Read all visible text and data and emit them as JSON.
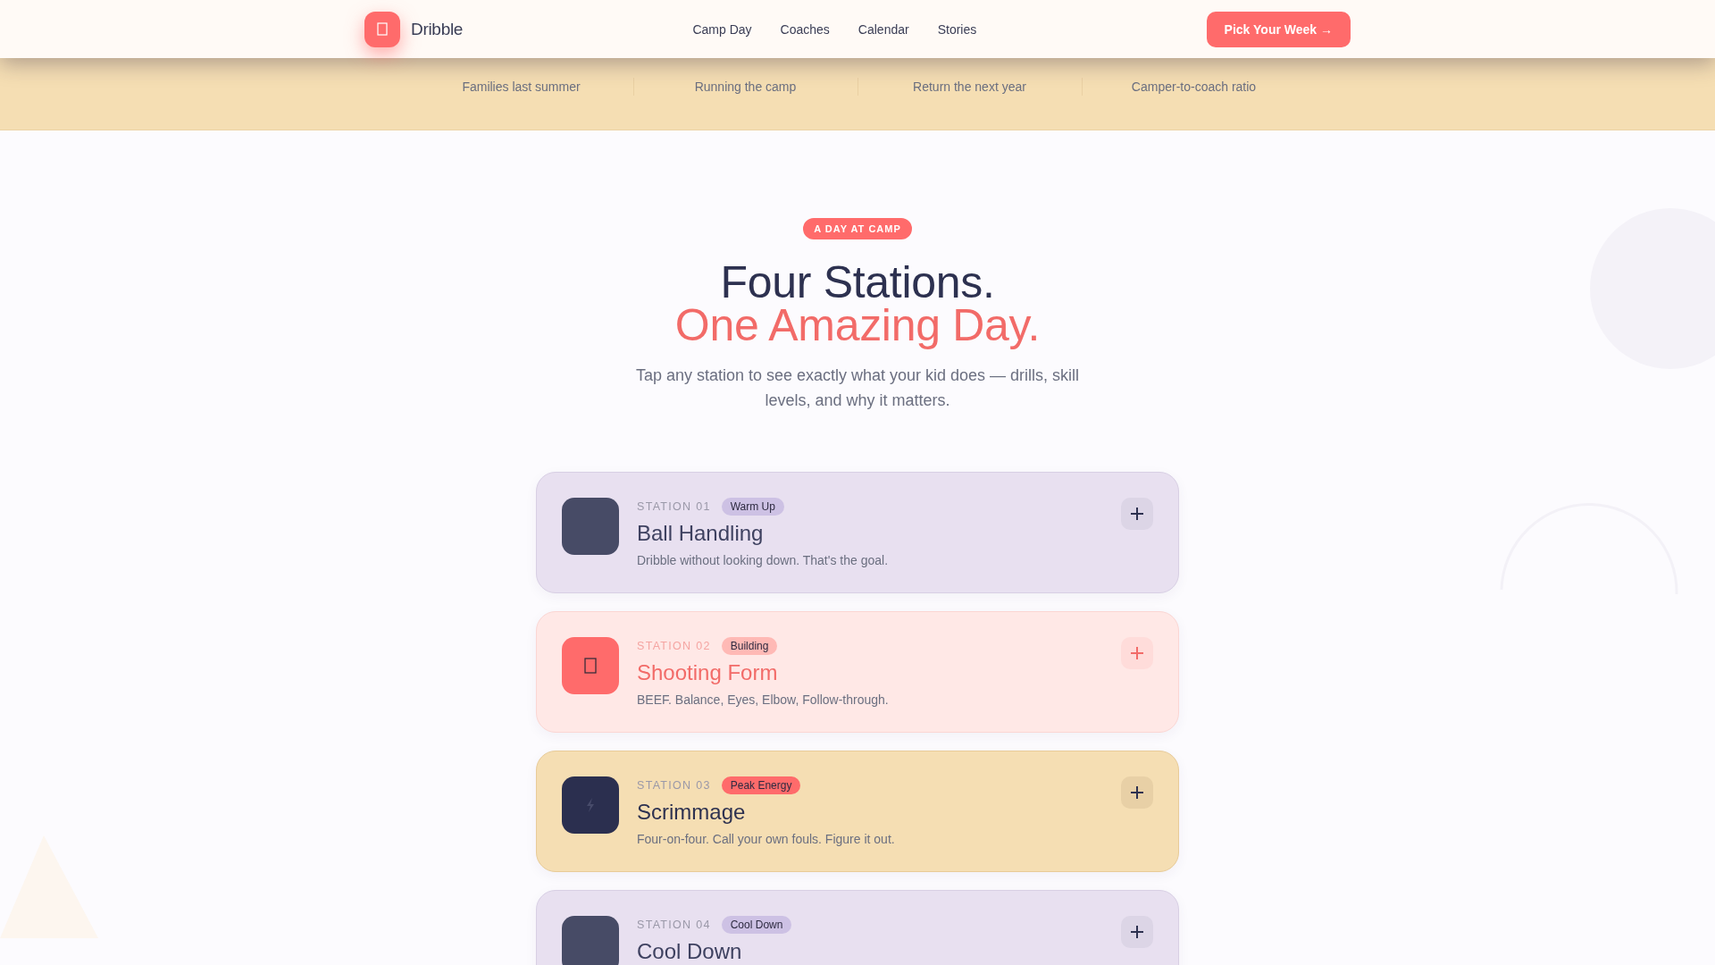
{
  "header": {
    "brand": "Dribble",
    "nav": [
      "Camp Day",
      "Coaches",
      "Calendar",
      "Stories"
    ],
    "cta": "Pick Your Week →"
  },
  "stats": [
    {
      "label": "Families last summer"
    },
    {
      "label": "Running the camp"
    },
    {
      "label": "Return the next year"
    },
    {
      "label": "Camper-to-coach ratio"
    }
  ],
  "section": {
    "eyebrow": "A DAY AT CAMP",
    "title": "Four Stations.",
    "title_accent": "One Amazing Day.",
    "subtitle": "Tap any station to see exactly what your kid does — drills, skill levels, and why it matters."
  },
  "stations": [
    {
      "number": "STATION 01",
      "tag": "Warm Up",
      "title": "Ball Handling",
      "description": "Dribble without looking down. That's the goal.",
      "kind": "lavender",
      "highlighted": false
    },
    {
      "number": "STATION 02",
      "tag": "Building",
      "title": "Shooting Form",
      "description": "BEEF. Balance, Eyes, Elbow, Follow-through.",
      "kind": "coral",
      "highlighted": true
    },
    {
      "number": "STATION 03",
      "tag": "Peak Energy",
      "title": "Scrimmage",
      "description": "Four-on-four. Call your own fouls. Figure it out.",
      "kind": "sand",
      "highlighted": false
    },
    {
      "number": "STATION 04",
      "tag": "Cool Down",
      "title": "Cool Down",
      "kind": "lavender",
      "highlighted": false
    }
  ]
}
